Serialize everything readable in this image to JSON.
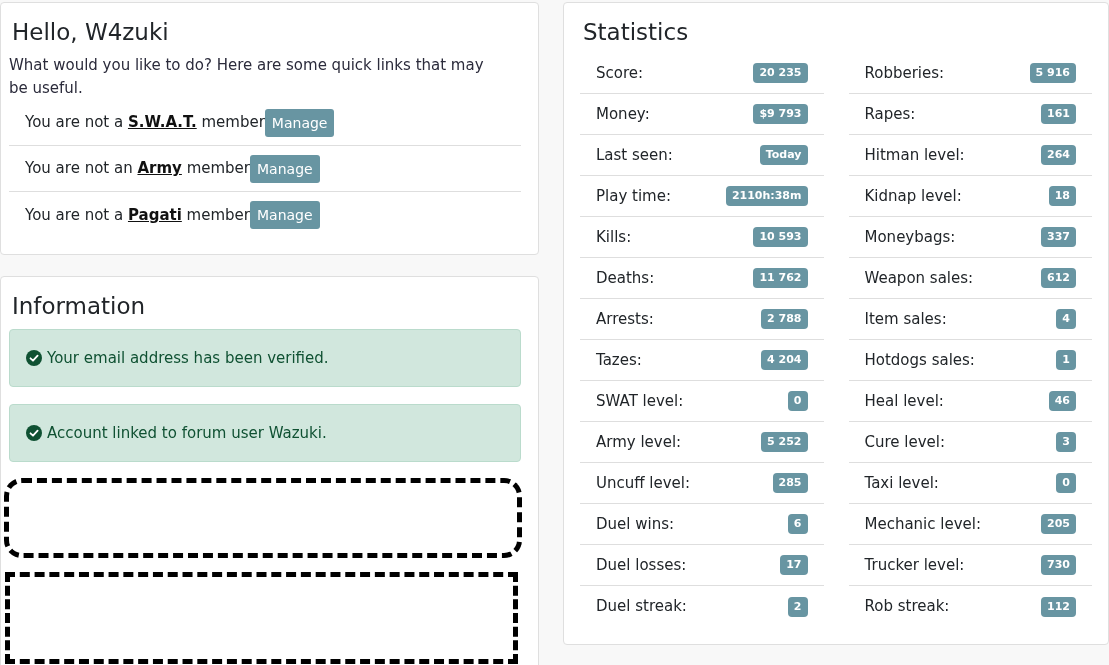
{
  "greeting_card": {
    "title": "Hello, W4zuki",
    "intro": "What would you like to do? Here are some quick links that may be useful.",
    "memberships": [
      {
        "before": "You are not a",
        "group": "S.W.A.T.",
        "after": "member",
        "button": "Manage"
      },
      {
        "before": "You are not an",
        "group": "Army",
        "after": "member",
        "button": "Manage"
      },
      {
        "before": "You are not a",
        "group": "Pagati",
        "after": "member",
        "button": "Manage"
      }
    ]
  },
  "information_card": {
    "title": "Information",
    "alerts": [
      {
        "kind": "success",
        "text": "Your email address has been verified."
      },
      {
        "kind": "success",
        "text": "Account linked to forum user Wazuki."
      }
    ],
    "redactions": [
      {
        "kind": "rounded"
      },
      {
        "kind": "square"
      }
    ]
  },
  "statistics_card": {
    "title": "Statistics",
    "columns": [
      {
        "rows": [
          {
            "label": "Score:",
            "value": "20 235"
          },
          {
            "label": "Money:",
            "value": "$9 793"
          },
          {
            "label": "Last seen:",
            "value": "Today"
          },
          {
            "label": "Play time:",
            "value": "2110h:38m"
          },
          {
            "label": "Kills:",
            "value": "10 593"
          },
          {
            "label": "Deaths:",
            "value": "11 762"
          },
          {
            "label": "Arrests:",
            "value": "2 788"
          },
          {
            "label": "Tazes:",
            "value": "4 204"
          },
          {
            "label": "SWAT level:",
            "value": "0"
          },
          {
            "label": "Army level:",
            "value": "5 252"
          },
          {
            "label": "Uncuff level:",
            "value": "285"
          },
          {
            "label": "Duel wins:",
            "value": "6"
          },
          {
            "label": "Duel losses:",
            "value": "17"
          },
          {
            "label": "Duel streak:",
            "value": "2"
          }
        ]
      },
      {
        "rows": [
          {
            "label": "Robberies:",
            "value": "5 916"
          },
          {
            "label": "Rapes:",
            "value": "161"
          },
          {
            "label": "Hitman level:",
            "value": "264"
          },
          {
            "label": "Kidnap level:",
            "value": "18"
          },
          {
            "label": "Moneybags:",
            "value": "337"
          },
          {
            "label": "Weapon sales:",
            "value": "612"
          },
          {
            "label": "Item sales:",
            "value": "4"
          },
          {
            "label": "Hotdogs sales:",
            "value": "1"
          },
          {
            "label": "Heal level:",
            "value": "46"
          },
          {
            "label": "Cure level:",
            "value": "3"
          },
          {
            "label": "Taxi level:",
            "value": "0"
          },
          {
            "label": "Mechanic level:",
            "value": "205"
          },
          {
            "label": "Trucker level:",
            "value": "730"
          },
          {
            "label": "Rob streak:",
            "value": "112"
          }
        ]
      }
    ]
  }
}
